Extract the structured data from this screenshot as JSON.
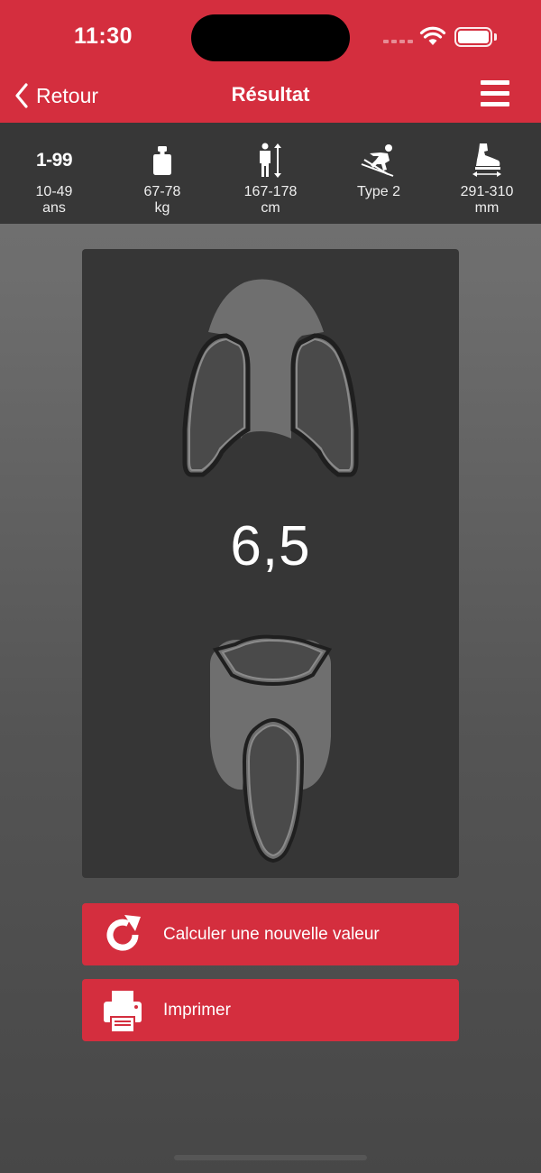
{
  "status_bar": {
    "time": "11:30"
  },
  "nav": {
    "back_label": "Retour",
    "title": "Résultat"
  },
  "info": {
    "age_icon_label": "1-99",
    "age": "10-49\nans",
    "weight": "67-78\nkg",
    "height": "167-178\ncm",
    "skier_type": "Type 2",
    "boot_sole": "291-310\nmm"
  },
  "result": {
    "din_value": "6,5"
  },
  "actions": {
    "recalculate_label": "Calculer une nouvelle valeur",
    "print_label": "Imprimer"
  },
  "colors": {
    "accent": "#d42e3e",
    "panel": "#363636",
    "infobar": "#373737"
  }
}
